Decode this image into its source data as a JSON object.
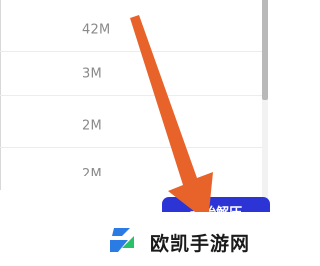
{
  "file_list": {
    "rows": [
      {
        "size": "42M"
      },
      {
        "size": "3M"
      },
      {
        "size": "2M"
      },
      {
        "size": "2M"
      }
    ]
  },
  "start_button": {
    "label": "开始解压"
  },
  "annotation": {
    "arrow_color": "#e8632a"
  },
  "watermark": {
    "text": "欧凯手游网",
    "logo_colors": [
      "#2a7be4",
      "#29c06a"
    ]
  }
}
